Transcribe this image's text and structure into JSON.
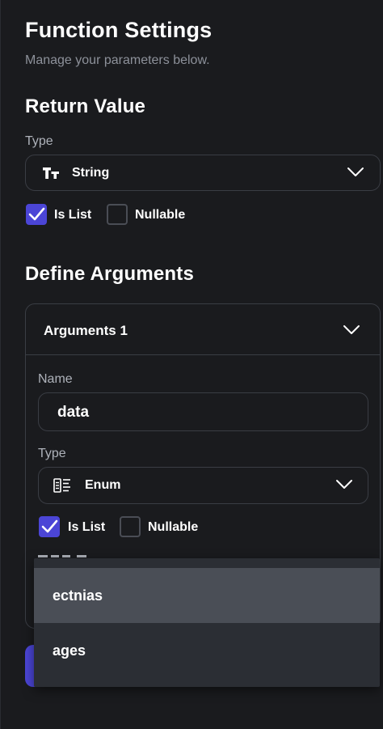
{
  "header": {
    "title": "Function Settings",
    "subtitle": "Manage your parameters below."
  },
  "return_value": {
    "heading": "Return Value",
    "type_label": "Type",
    "type_value": "String",
    "type_icon": "text-type-icon",
    "is_list_label": "Is List",
    "is_list_checked": true,
    "nullable_label": "Nullable",
    "nullable_checked": false
  },
  "define_arguments": {
    "heading": "Define Arguments",
    "argument": {
      "title": "Arguments 1",
      "name_label": "Name",
      "name_value": "data",
      "type_label": "Type",
      "type_value": "Enum",
      "type_icon": "enum-list-icon",
      "is_list_label": "Is List",
      "is_list_checked": true,
      "nullable_label": "Nullable",
      "nullable_checked": false
    }
  },
  "dropdown": {
    "options": [
      "ectnias",
      "ages"
    ],
    "highlighted_index": 0
  },
  "colors": {
    "accent": "#4b45d6",
    "background": "#1a1b1e",
    "border": "#3a3d44"
  }
}
